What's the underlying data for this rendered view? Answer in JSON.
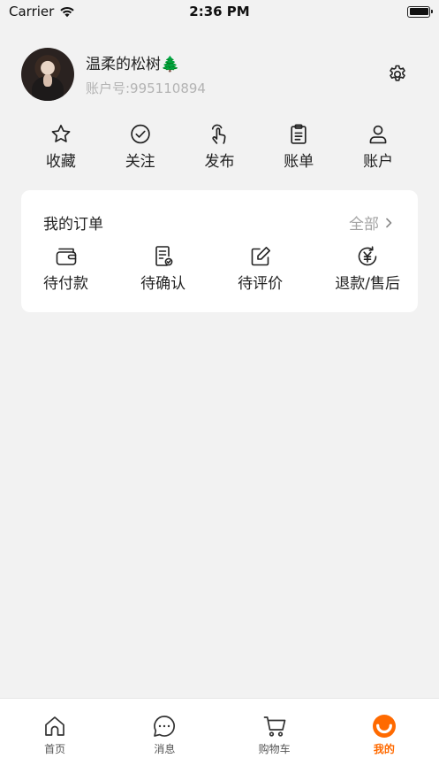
{
  "status_bar": {
    "carrier": "Carrier",
    "time": "2:36 PM",
    "icons": [
      "wifi-icon",
      "battery-icon"
    ]
  },
  "profile": {
    "username": "温柔的松树🌲",
    "account_id": "账户号:995110894",
    "settings_icon": "gear-icon"
  },
  "quick_actions": [
    {
      "label": "收藏",
      "icon": "star-icon"
    },
    {
      "label": "关注",
      "icon": "check-circle-icon"
    },
    {
      "label": "发布",
      "icon": "tap-hand-icon"
    },
    {
      "label": "账单",
      "icon": "clipboard-icon"
    },
    {
      "label": "账户",
      "icon": "user-icon"
    }
  ],
  "orders": {
    "title": "我的订单",
    "view_all": "全部",
    "items": [
      {
        "label": "待付款",
        "icon": "wallet-icon"
      },
      {
        "label": "待确认",
        "icon": "receipt-check-icon"
      },
      {
        "label": "待评价",
        "icon": "edit-icon"
      },
      {
        "label": "退款/售后",
        "icon": "yen-refund-icon"
      }
    ]
  },
  "tab_bar": {
    "tabs": [
      {
        "label": "首页",
        "icon": "home-icon",
        "active": false
      },
      {
        "label": "消息",
        "icon": "chat-icon",
        "active": false
      },
      {
        "label": "购物车",
        "icon": "cart-icon",
        "active": false
      },
      {
        "label": "我的",
        "icon": "smile-icon",
        "active": true
      }
    ],
    "active_color": "#ff6a00"
  },
  "colors": {
    "background": "#f2f2f2",
    "card": "#ffffff",
    "accent": "#ff6a00",
    "muted_text": "#b3b3b3"
  }
}
